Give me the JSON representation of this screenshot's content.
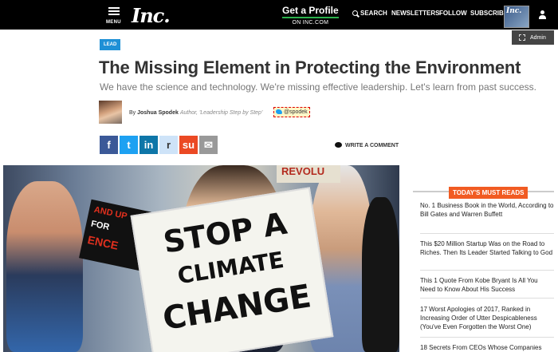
{
  "header": {
    "menu_label": "MENU",
    "logo": "Inc.",
    "promo_title": "Get a Profile",
    "promo_sub": "ON INC.COM",
    "search_label": "SEARCH",
    "newsletters_label": "NEWSLETTERS",
    "follow_label": "FOLLOW",
    "subscribe_label": "SUBSCRIBE",
    "magazine_logo": "Inc."
  },
  "admin": {
    "label": "Admin"
  },
  "article": {
    "tag": "LEAD",
    "headline": "The Missing Element in Protecting the Environment",
    "dek": "We have the science and technology. We're missing effective leadership. Let's learn from past success.",
    "byline_prefix": "By",
    "author": "Joshua Spodek",
    "author_title": "Author, 'Leadership Step by Step'",
    "twitter_handle": "@spodek",
    "comment_label": "WRITE A COMMENT"
  },
  "share_buttons": [
    {
      "name": "facebook",
      "glyph": "f",
      "color": "#3b5998"
    },
    {
      "name": "twitter",
      "glyph": "t",
      "color": "#1da1f2"
    },
    {
      "name": "linkedin",
      "glyph": "in",
      "color": "#0e76a8"
    },
    {
      "name": "reddit",
      "glyph": "r",
      "color": "#cee3f8"
    },
    {
      "name": "stumbleupon",
      "glyph": "su",
      "color": "#eb4924"
    },
    {
      "name": "email",
      "glyph": "✉",
      "color": "#999999"
    }
  ],
  "hero": {
    "sign_lines": [
      "STOP A",
      "CLIMATE",
      "CHANGE"
    ],
    "small_sign_lines": [
      "AND UP",
      "FOR",
      "ENCE"
    ],
    "banner_text": "REVOLU"
  },
  "sidebar": {
    "heading": "TODAY'S MUST READS",
    "items": [
      "No. 1 Business Book in the World, According to Bill Gates and Warren Buffett",
      "This $20 Million Startup Was on the Road to Riches. Then Its Leader Started Talking to God",
      "This 1 Quote From Kobe Bryant Is All You Need to Know About His Success",
      "17 Worst Apologies of 2017, Ranked in Increasing Order of Utter Despicableness (You've Even Forgotten the Worst One)",
      "18 Secrets From CEOs Whose Companies"
    ]
  }
}
